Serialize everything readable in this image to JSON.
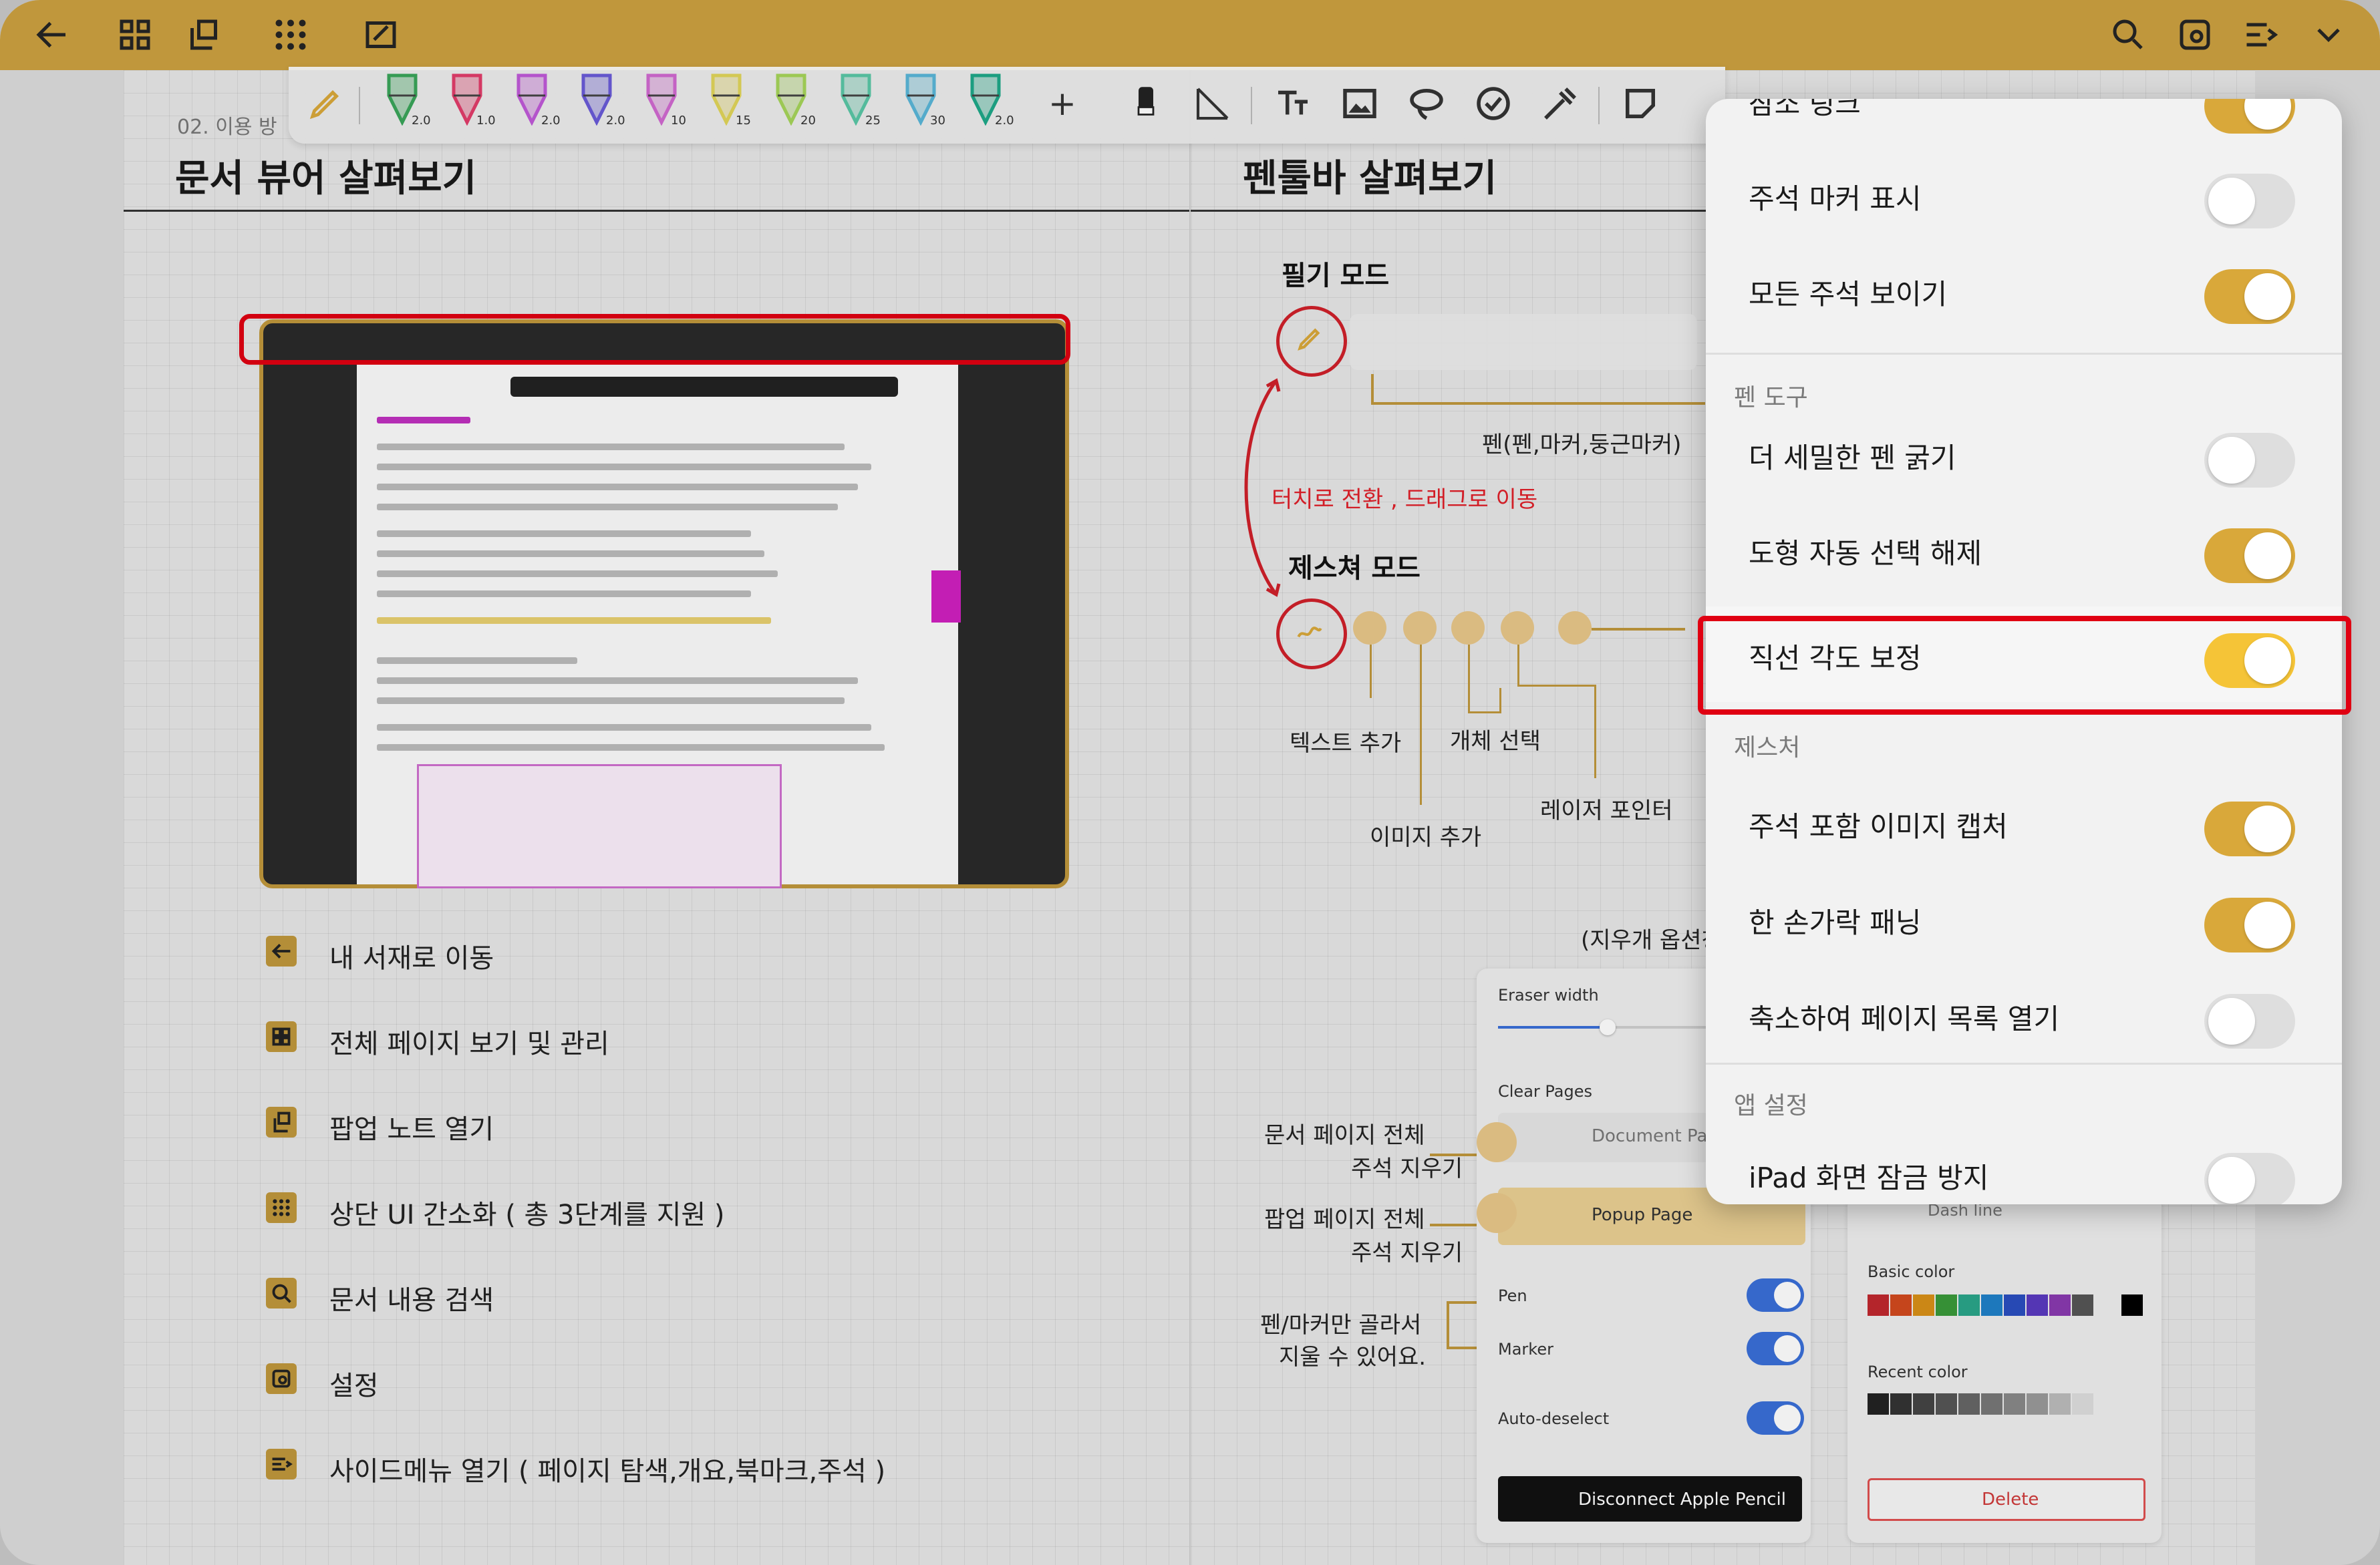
{
  "top_bar": {
    "icons": [
      "arrow-left-icon",
      "grid-icon",
      "popup-note-icon",
      "dots-grid-icon",
      "simplify-ui-icon",
      "search-icon",
      "settings-icon",
      "side-menu-icon",
      "chevron-down-icon"
    ]
  },
  "pen_toolbar": {
    "pens": [
      {
        "color": "#3aa55a",
        "size": "2.0"
      },
      {
        "color": "#e23d6b",
        "size": "1.0"
      },
      {
        "color": "#c05ad8",
        "size": "2.0"
      },
      {
        "color": "#6a5bd8",
        "size": "2.0"
      },
      {
        "color": "#d16ad1",
        "size": "10"
      },
      {
        "color": "#e1d55a",
        "size": "15"
      },
      {
        "color": "#a6d55a",
        "size": "20"
      },
      {
        "color": "#5ac7a6",
        "size": "25"
      },
      {
        "color": "#5ab6d8",
        "size": "30"
      },
      {
        "color": "#1ea888",
        "size": "2.0"
      }
    ],
    "add_label": "+"
  },
  "left": {
    "breadcrumb": "02. 이용 방",
    "title": "문서 뷰어 살펴보기",
    "legend": [
      {
        "icon": "arrow-left-icon",
        "text": "내 서재로 이동"
      },
      {
        "icon": "grid-icon",
        "text": "전체 페이지 보기 및 관리"
      },
      {
        "icon": "popup-note-icon",
        "text": "팝업 노트 열기"
      },
      {
        "icon": "dots-grid-icon",
        "text": "상단 UI 간소화 ( 총 3단계를 지원 )"
      },
      {
        "icon": "search-icon",
        "text": "문서 내용 검색"
      },
      {
        "icon": "settings-icon",
        "text": "설정"
      },
      {
        "icon": "side-menu-icon",
        "text": "사이드메뉴 열기 ( 페이지 탐색,개요,북마크,주석 )"
      }
    ]
  },
  "right": {
    "title": "펜툴바 살펴보기",
    "writing_mode": "필기 모드",
    "pen_note": "펜(펜,마커,둥근마커)",
    "switch_note": "터치로 전환 , 드래그로 이동",
    "gesture_mode": "제스쳐 모드",
    "text_add": "텍스트 추가",
    "object_select": "개체 선택",
    "laser_pointer": "레이저 포인터",
    "image_add": "이미지 추가",
    "eraser_options": "(지우개 옵션창",
    "doc_clear_1": "문서 페이지 전체",
    "doc_clear_2": "주석 지우기",
    "popup_clear_1": "팝업 페이지 전체",
    "popup_clear_2": "주석 지우기",
    "pen_marker_1": "펜/마커만 골라서",
    "pen_marker_2": "지울 수 있어요."
  },
  "eraser_panel": {
    "eraser_width": "Eraser width",
    "clear_pages": "Clear Pages",
    "document_page": "Document Pag",
    "popup_page": "Popup Page",
    "pen": "Pen",
    "marker": "Marker",
    "auto_deselect": "Auto-deselect",
    "disconnect": "Disconnect Apple Pencil"
  },
  "color_panel": {
    "dash_line": "Dash line",
    "basic_color": "Basic color",
    "recent_color": "Recent color",
    "delete": "Delete",
    "basic_swatches": [
      "#c0282e",
      "#d24a1e",
      "#d89018",
      "#3a9a3a",
      "#2aa58a",
      "#1f80c8",
      "#2a4ec0",
      "#5a3ac0",
      "#8a3ab0",
      "#555555"
    ],
    "recent_swatches": [
      "#222222",
      "#333333",
      "#444444",
      "#555555",
      "#666666",
      "#777777",
      "#888888",
      "#999999",
      "#bbbbbb",
      "#dddddd"
    ]
  },
  "settings_panel": {
    "rows": [
      {
        "label": "잠소 링크",
        "on": true
      },
      {
        "label": "주석 마커 표시",
        "on": false
      },
      {
        "label": "모든 주석 보이기",
        "on": true
      }
    ],
    "section_pen": "펜 도구",
    "pen_rows": [
      {
        "label": "더 세밀한 펜 굵기",
        "on": false
      },
      {
        "label": "도형 자동 선택 해제",
        "on": true
      },
      {
        "label": "직선 각도 보정",
        "on": true
      }
    ],
    "section_gesture": "제스처",
    "gesture_rows": [
      {
        "label": "주석 포함 이미지 캡처",
        "on": true
      },
      {
        "label": "한 손가락 패닝",
        "on": true
      },
      {
        "label": "축소하여 페이지 목록 열기",
        "on": false
      }
    ],
    "section_app": "앱 설정",
    "app_rows": [
      {
        "label": "iPad 화면 잠금 방지",
        "on": false
      }
    ]
  }
}
